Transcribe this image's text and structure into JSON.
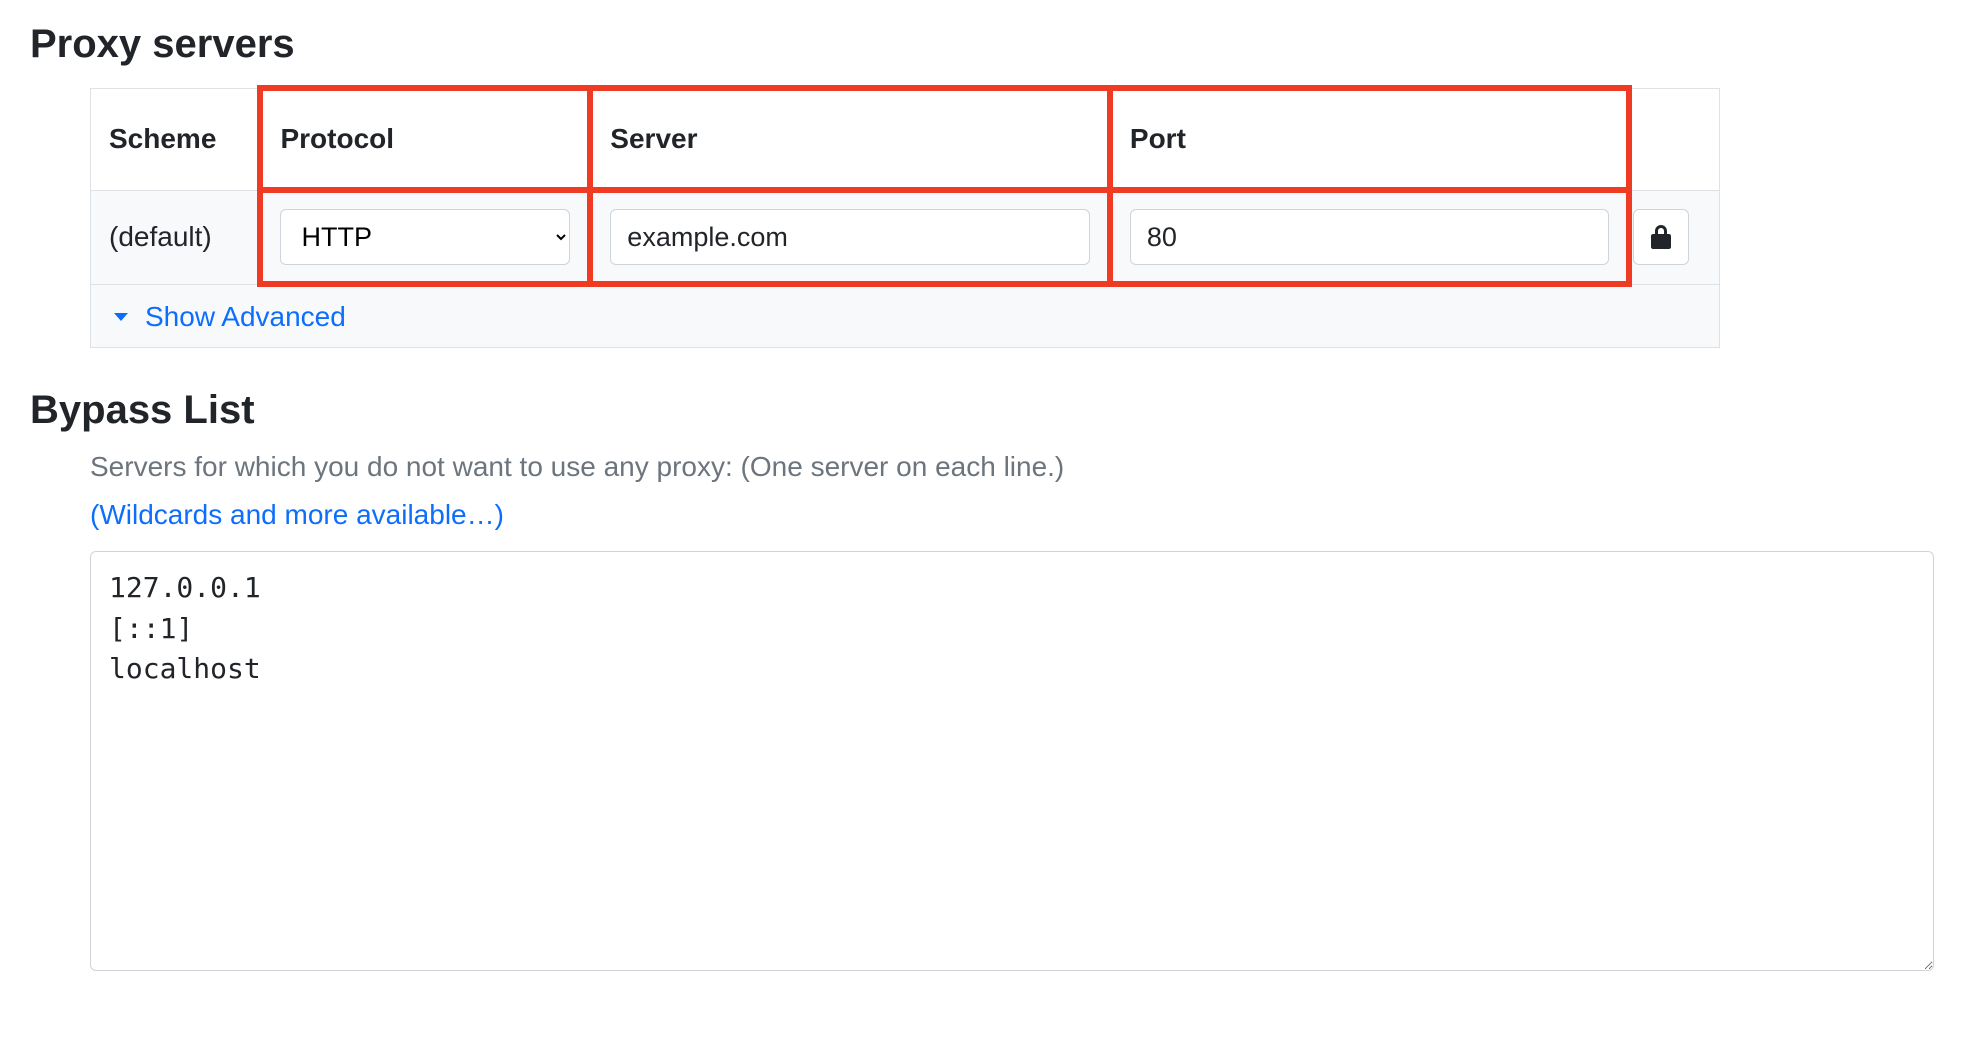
{
  "proxy_servers": {
    "title": "Proxy servers",
    "columns": {
      "scheme": "Scheme",
      "protocol": "Protocol",
      "server": "Server",
      "port": "Port"
    },
    "row": {
      "scheme": "(default)",
      "protocol": "HTTP",
      "server": "example.com",
      "port": "80"
    },
    "show_advanced": "Show Advanced"
  },
  "bypass": {
    "title": "Bypass List",
    "description": "Servers for which you do not want to use any proxy: (One server on each line.)",
    "wildcards_link": "(Wildcards and more available…)",
    "value": "127.0.0.1\n[::1]\nlocalhost"
  }
}
